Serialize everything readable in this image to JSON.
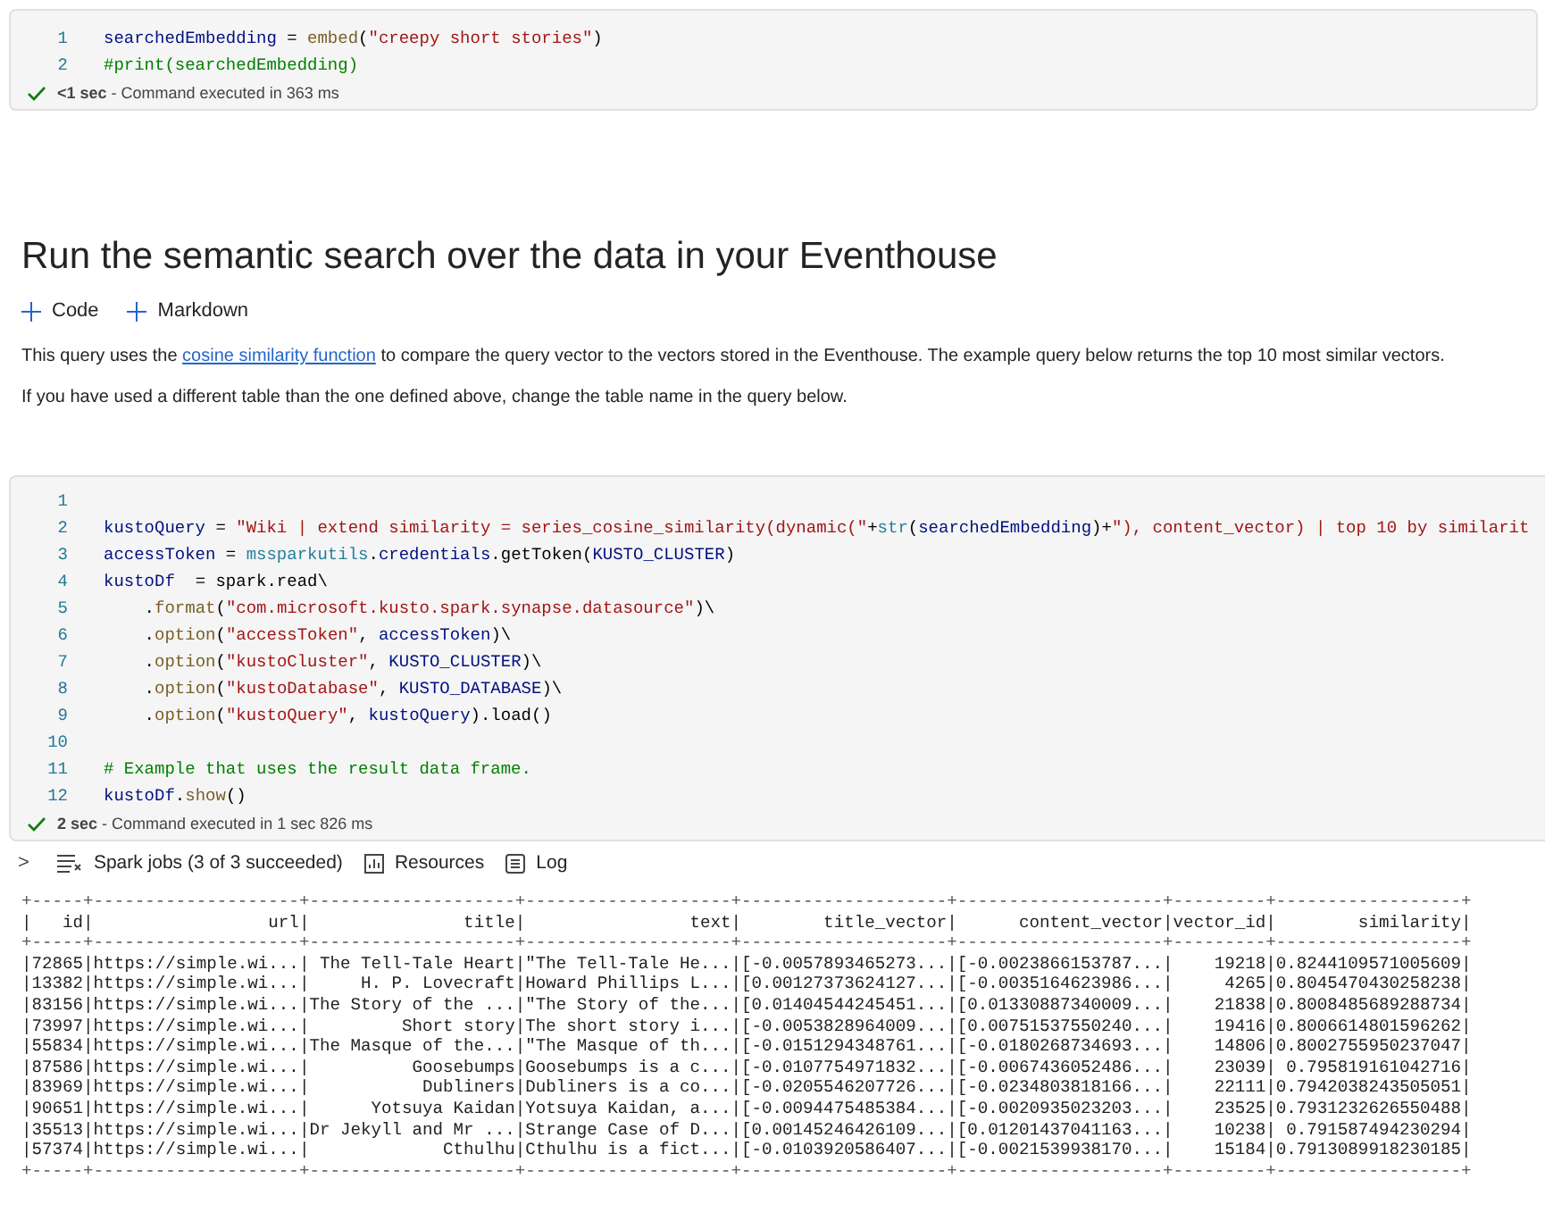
{
  "cells_top": {
    "lines": [
      {
        "number": "1",
        "tokens": [
          {
            "kind": "var",
            "text": "searchedEmbedding"
          },
          {
            "kind": "plain",
            "text": " = "
          },
          {
            "kind": "func",
            "text": "embed"
          },
          {
            "kind": "plain",
            "text": "("
          },
          {
            "kind": "string",
            "text": "\"creepy short stories\""
          },
          {
            "kind": "plain",
            "text": ")"
          }
        ]
      },
      {
        "number": "2",
        "tokens": [
          {
            "kind": "comment",
            "text": "#print(searchedEmbedding)"
          }
        ]
      }
    ],
    "status": "**<1 sec** - Command executed in 363 ms"
  },
  "heading": "Run the semantic search over the data in your Eventhouse",
  "add_buttons": [
    {
      "label": "Code"
    },
    {
      "label": "Markdown"
    }
  ],
  "paragraphs": [
    {
      "before": "This query uses the ",
      "link": "cosine similarity function",
      "after": " to compare the query vector to the vectors stored in the Eventhouse. The example query below returns the top 10 most similar vectors."
    },
    {
      "before": "If you have used a different table than the one defined above, change the table name in the query below."
    }
  ],
  "query_cell": {
    "lines": [
      {
        "number": "1"
      },
      {
        "number": "2",
        "tokens": [
          {
            "kind": "var",
            "text": "kustoQuery"
          },
          {
            "kind": "plain",
            "text": " = "
          },
          {
            "kind": "string",
            "text": "\"Wiki | extend similarity = series_cosine_similarity(dynamic(\""
          },
          {
            "kind": "plain",
            "text": "+"
          },
          {
            "kind": "builtin",
            "text": "str"
          },
          {
            "kind": "plain",
            "text": "("
          },
          {
            "kind": "var",
            "text": "searchedEmbedding"
          },
          {
            "kind": "plain",
            "text": ")+"
          },
          {
            "kind": "string",
            "text": "\"), content_vector) | top 10 by similarit"
          }
        ]
      },
      {
        "number": "3",
        "tokens": [
          {
            "kind": "var",
            "text": "accessToken"
          },
          {
            "kind": "plain",
            "text": " = "
          },
          {
            "kind": "builtin",
            "text": "mssparkutils"
          },
          {
            "kind": "plain",
            "text": "."
          },
          {
            "kind": "var",
            "text": "credentials"
          },
          {
            "kind": "plain",
            "text": ".getToken("
          },
          {
            "kind": "var",
            "text": "KUSTO_CLUSTER"
          },
          {
            "kind": "plain",
            "text": ")"
          }
        ]
      },
      {
        "number": "4",
        "tokens": [
          {
            "kind": "var",
            "text": "kustoDf"
          },
          {
            "kind": "plain",
            "text": "  = spark.read\\"
          }
        ]
      },
      {
        "number": "5",
        "tokens": [
          {
            "kind": "plain",
            "text": "    ."
          },
          {
            "kind": "func",
            "text": "format"
          },
          {
            "kind": "plain",
            "text": "("
          },
          {
            "kind": "string",
            "text": "\"com.microsoft.kusto.spark.synapse.datasource\""
          },
          {
            "kind": "plain",
            "text": ")\\"
          }
        ]
      },
      {
        "number": "6",
        "tokens": [
          {
            "kind": "plain",
            "text": "    ."
          },
          {
            "kind": "func",
            "text": "option"
          },
          {
            "kind": "plain",
            "text": "("
          },
          {
            "kind": "string",
            "text": "\"accessToken\""
          },
          {
            "kind": "plain",
            "text": ", "
          },
          {
            "kind": "var",
            "text": "accessToken"
          },
          {
            "kind": "plain",
            "text": ")\\"
          }
        ]
      },
      {
        "number": "7",
        "tokens": [
          {
            "kind": "plain",
            "text": "    ."
          },
          {
            "kind": "func",
            "text": "option"
          },
          {
            "kind": "plain",
            "text": "("
          },
          {
            "kind": "string",
            "text": "\"kustoCluster\""
          },
          {
            "kind": "plain",
            "text": ", "
          },
          {
            "kind": "var",
            "text": "KUSTO_CLUSTER"
          },
          {
            "kind": "plain",
            "text": ")\\"
          }
        ]
      },
      {
        "number": "8",
        "tokens": [
          {
            "kind": "plain",
            "text": "    ."
          },
          {
            "kind": "func",
            "text": "option"
          },
          {
            "kind": "plain",
            "text": "("
          },
          {
            "kind": "string",
            "text": "\"kustoDatabase\""
          },
          {
            "kind": "plain",
            "text": ", "
          },
          {
            "kind": "var",
            "text": "KUSTO_DATABASE"
          },
          {
            "kind": "plain",
            "text": ")\\"
          }
        ]
      },
      {
        "number": "9",
        "tokens": [
          {
            "kind": "plain",
            "text": "    ."
          },
          {
            "kind": "func",
            "text": "option"
          },
          {
            "kind": "plain",
            "text": "("
          },
          {
            "kind": "string",
            "text": "\"kustoQuery\""
          },
          {
            "kind": "plain",
            "text": ", "
          },
          {
            "kind": "var",
            "text": "kustoQuery"
          },
          {
            "kind": "plain",
            "text": ").load()"
          }
        ]
      },
      {
        "number": "10"
      },
      {
        "number": "11",
        "tokens": [
          {
            "kind": "comment",
            "text": "# Example that uses the result data frame."
          }
        ]
      },
      {
        "number": "12",
        "tokens": [
          {
            "kind": "var",
            "text": "kustoDf"
          },
          {
            "kind": "plain",
            "text": "."
          },
          {
            "kind": "func",
            "text": "show"
          },
          {
            "kind": "plain",
            "text": "()"
          }
        ]
      }
    ],
    "status": "**2 sec** - Command executed in 1 sec 826 ms"
  },
  "output_tabs": [
    {
      "kind": "jobs",
      "label": "Spark jobs (3 of 3 succeeded)"
    },
    {
      "kind": "resources",
      "label": "Resources"
    },
    {
      "kind": "log",
      "label": "Log"
    }
  ],
  "expander": ">",
  "table_output": [
    {
      "kind": "border",
      "text": "+-----+--------------------+--------------------+--------------------+--------------------+--------------------+---------+------------------+"
    },
    {
      "kind": "header",
      "text": "|   id|                 url|               title|                text|        title_vector|      content_vector|vector_id|        similarity|"
    },
    {
      "kind": "border",
      "text": "+-----+--------------------+--------------------+--------------------+--------------------+--------------------+---------+------------------+"
    },
    {
      "kind": "row",
      "text": "|72865|https://simple.wi...| The Tell-Tale Heart|\"The Tell-Tale He...|[-0.0057893465273...|[-0.0023866153787...|    19218|0.8244109571005609|"
    },
    {
      "kind": "row",
      "text": "|13382|https://simple.wi...|     H. P. Lovecraft|Howard Phillips L...|[0.00127373624127...|[-0.0035164623986...|     4265|0.8045470430258238|"
    },
    {
      "kind": "row",
      "text": "|83156|https://simple.wi...|The Story of the ...|\"The Story of the...|[0.01404544245451...|[0.01330887340009...|    21838|0.8008485689288734|"
    },
    {
      "kind": "row",
      "text": "|73997|https://simple.wi...|         Short story|The short story i...|[-0.0053828964009...|[0.00751537550240...|    19416|0.8006614801596262|"
    },
    {
      "kind": "row",
      "text": "|55834|https://simple.wi...|The Masque of the...|\"The Masque of th...|[-0.0151294348761...|[-0.0180268734693...|    14806|0.8002755950237047|"
    },
    {
      "kind": "row",
      "text": "|87586|https://simple.wi...|          Goosebumps|Goosebumps is a c...|[-0.0107754971832...|[-0.0067436052486...|    23039| 0.795819161042716|"
    },
    {
      "kind": "row",
      "text": "|83969|https://simple.wi...|           Dubliners|Dubliners is a co...|[-0.0205546207726...|[-0.0234803818166...|    22111|0.7942038243505051|"
    },
    {
      "kind": "row",
      "text": "|90651|https://simple.wi...|      Yotsuya Kaidan|Yotsuya Kaidan, a...|[-0.0094475485384...|[-0.0020935023203...|    23525|0.7931232626550488|"
    },
    {
      "kind": "row",
      "text": "|35513|https://simple.wi...|Dr Jekyll and Mr ...|Strange Case of D...|[0.00145246426109...|[0.01201437041163...|    10238| 0.791587494230294|"
    },
    {
      "kind": "row",
      "text": "|57374|https://simple.wi...|             Cthulhu|Cthulhu is a fict...|[-0.0103920586407...|[-0.0021539938170...|    15184|0.7913089918230185|"
    },
    {
      "kind": "border",
      "text": "+-----+--------------------+--------------------+--------------------+--------------------+--------------------+---------+------------------+"
    }
  ]
}
